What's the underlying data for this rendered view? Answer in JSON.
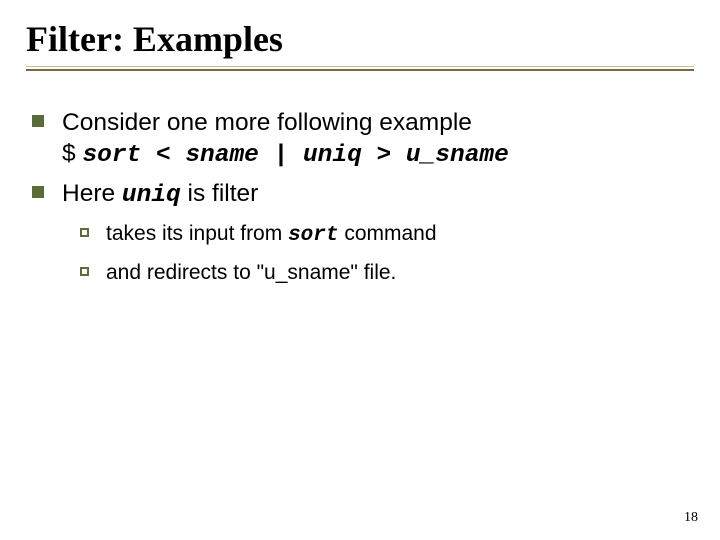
{
  "title": "Filter: Examples",
  "bullets": {
    "b1": {
      "line1": "Consider one more following example",
      "line2_prefix": "$ ",
      "line2_code": "sort < sname | uniq > u_sname"
    },
    "b2": {
      "pre": "Here ",
      "code": "uniq",
      "post": " is filter"
    }
  },
  "sub": {
    "s1": {
      "pre": "takes its input from ",
      "code": "sort",
      "post": " command"
    },
    "s2": {
      "text": "and redirects to \"u_sname\" file."
    }
  },
  "page_number": "18"
}
